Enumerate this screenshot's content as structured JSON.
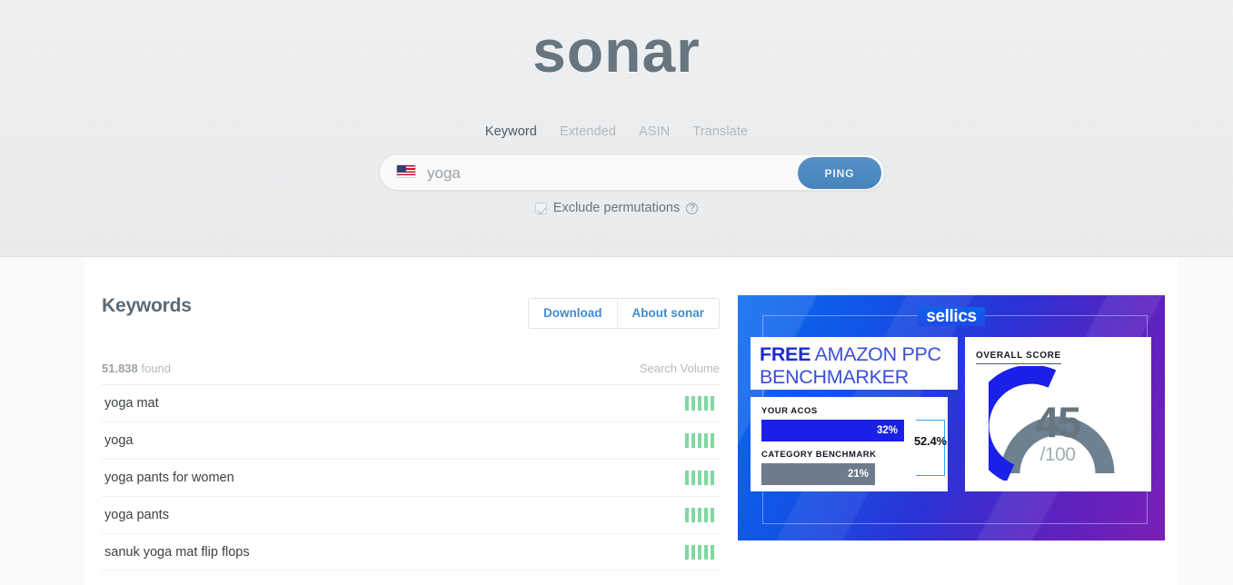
{
  "brand": {
    "logo": "sonar"
  },
  "tabs": [
    {
      "label": "Keyword",
      "active": true
    },
    {
      "label": "Extended",
      "active": false
    },
    {
      "label": "ASIN",
      "active": false
    },
    {
      "label": "Translate",
      "active": false
    }
  ],
  "search": {
    "marketplace_flag": "us-flag-icon",
    "value": "yoga",
    "placeholder": "yoga",
    "button_label": "PING"
  },
  "options": {
    "exclude_permutations_label": "Exclude permutations",
    "exclude_permutations_checked": true,
    "help_icon": "question-mark-icon"
  },
  "results": {
    "title": "Keywords",
    "download_label": "Download",
    "about_label": "About sonar",
    "found_count": "51.838",
    "found_suffix": "found",
    "volume_header": "Search Volume",
    "rows": [
      {
        "keyword": "yoga mat",
        "bars": 5
      },
      {
        "keyword": "yoga",
        "bars": 5
      },
      {
        "keyword": "yoga pants for women",
        "bars": 5
      },
      {
        "keyword": "yoga pants",
        "bars": 5
      },
      {
        "keyword": "sanuk yoga mat flip flops",
        "bars": 5
      }
    ]
  },
  "banner": {
    "logo": "sellics",
    "headline_strong": "FREE",
    "headline_rest": " AMAZON PPC",
    "headline_line2": "BENCHMARKER",
    "acos_label": "YOUR ACOS",
    "acos_value": "32%",
    "benchmark_label": "CATEGORY BENCHMARK",
    "benchmark_value": "21%",
    "delta_value": "52.4%",
    "score_label": "OVERALL SCORE",
    "score_value": "45",
    "score_max": "/100"
  },
  "colors": {
    "accent_blue": "#3f8cd7",
    "ping_blue": "#4784bd",
    "bar_green": "#7fd9a0",
    "banner_blue": "#0b6df0",
    "banner_purple": "#7a1fb5",
    "score_gauge_blue": "#1a20e8",
    "score_gauge_gray": "#6e8190",
    "logo_gray": "#66757f"
  }
}
